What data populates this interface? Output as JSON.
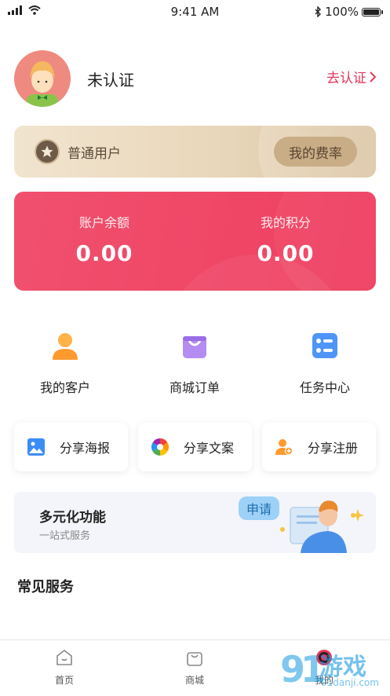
{
  "status_bar": {
    "time": "9:41 AM",
    "battery": "100%"
  },
  "profile": {
    "status": "未认证",
    "verify_link": "去认证"
  },
  "membership": {
    "level": "普通用户",
    "rate_button": "我的费率"
  },
  "balance": {
    "account_label": "账户余额",
    "account_value": "0.00",
    "points_label": "我的积分",
    "points_value": "0.00"
  },
  "quick_actions": [
    {
      "label": "我的客户",
      "icon": "user-icon"
    },
    {
      "label": "商城订单",
      "icon": "shopping-bag-icon"
    },
    {
      "label": "任务中心",
      "icon": "task-list-icon"
    }
  ],
  "share_actions": [
    {
      "label": "分享海报",
      "icon": "image-icon"
    },
    {
      "label": "分享文案",
      "icon": "aperture-icon"
    },
    {
      "label": "分享注册",
      "icon": "add-user-icon"
    }
  ],
  "promo": {
    "title": "多元化功能",
    "subtitle": "一站式服务",
    "badge": "申请"
  },
  "section": {
    "title": "常见服务"
  },
  "tabbar": [
    {
      "label": "首页",
      "icon": "home-icon"
    },
    {
      "label": "商城",
      "icon": "shop-bag-icon"
    },
    {
      "label": "我的",
      "icon": "profile-icon"
    }
  ],
  "watermark": {
    "brand": "游戏",
    "url": "91danji.com"
  },
  "colors": {
    "accent": "#e8355c",
    "balance_card": "#f04867",
    "member_card": "#e8d6b9"
  }
}
